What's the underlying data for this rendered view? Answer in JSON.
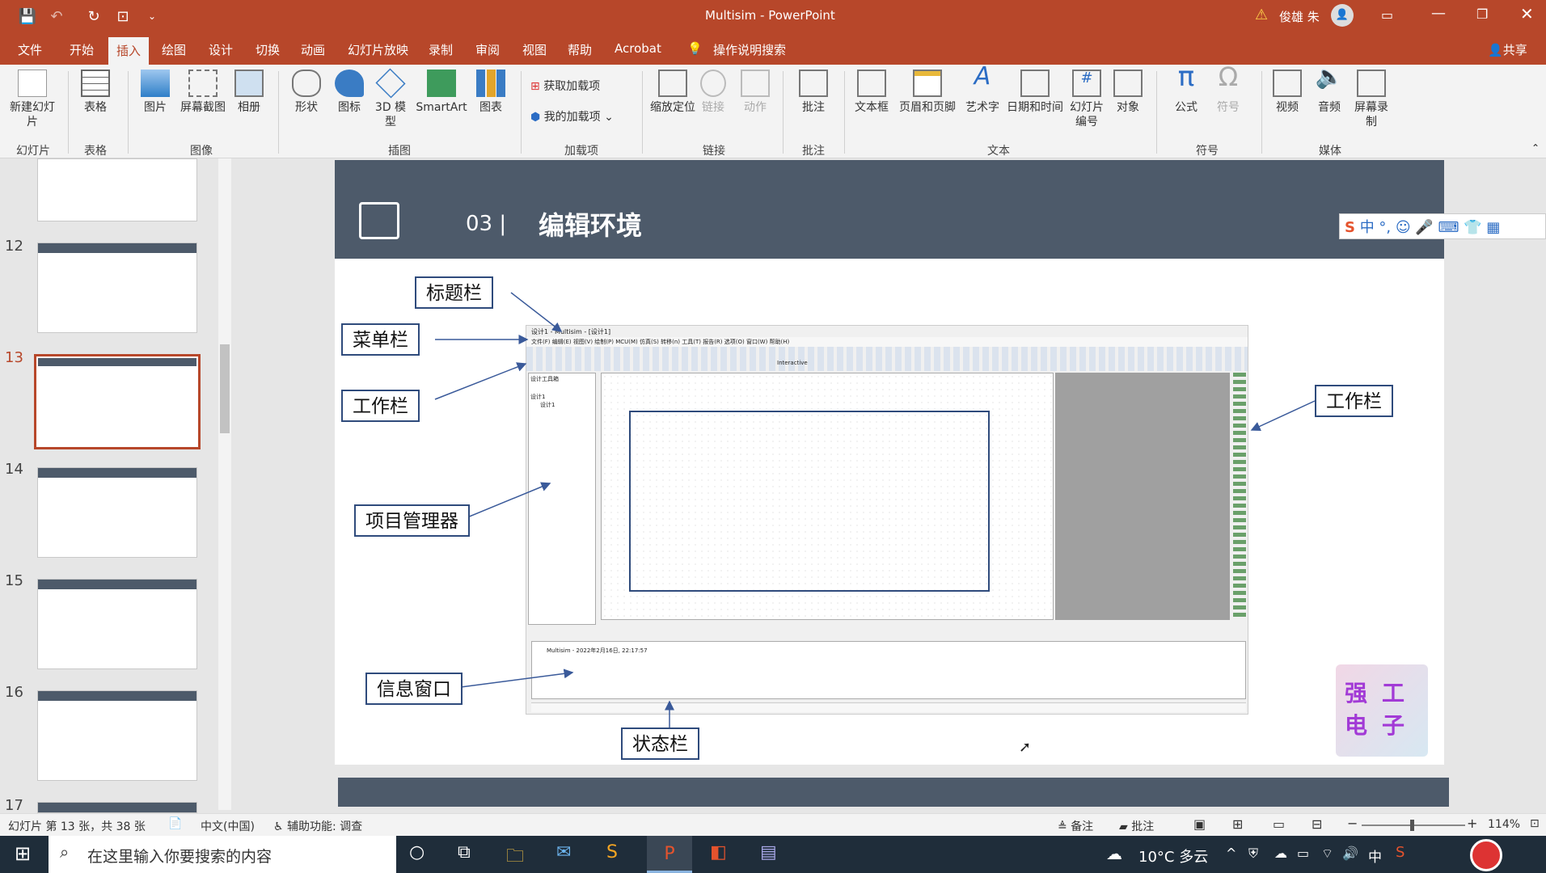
{
  "window": {
    "title": "Multisim  -  PowerPoint",
    "user": "俊雄 朱",
    "share": "共享",
    "warning_icon": "warning-icon"
  },
  "tabs": [
    "文件",
    "开始",
    "插入",
    "绘图",
    "设计",
    "切换",
    "动画",
    "幻灯片放映",
    "录制",
    "审阅",
    "视图",
    "帮助",
    "Acrobat"
  ],
  "tell_me": "操作说明搜索",
  "ribbon": {
    "new_slide": "新建幻灯片",
    "table": "表格",
    "picture": "图片",
    "screenshot": "屏幕截图",
    "album": "相册",
    "shapes": "形状",
    "icons": "图标",
    "3d": "3D 模型",
    "smartart": "SmartArt",
    "chart": "图表",
    "get_addins": "获取加载项",
    "my_addins": "我的加载项",
    "zoom": "缩放定位",
    "link": "链接",
    "action": "动作",
    "comment": "批注",
    "textbox": "文本框",
    "header_footer": "页眉和页脚",
    "wordart": "艺术字",
    "datetime": "日期和时间",
    "slide_num": "幻灯片编号",
    "object": "对象",
    "equation": "公式",
    "symbol": "符号",
    "video": "视频",
    "audio": "音频",
    "screen_rec": "屏幕录制",
    "groups": {
      "slides": "幻灯片",
      "tables": "表格",
      "images": "图像",
      "illustrations": "插图",
      "addins": "加载项",
      "links": "链接",
      "comments": "批注",
      "text": "文本",
      "symbols": "符号",
      "media": "媒体"
    }
  },
  "thumbs": [
    "12",
    "13",
    "14",
    "15",
    "16",
    "17"
  ],
  "slide": {
    "number": "03 |",
    "heading": "编辑环境",
    "callouts": {
      "title_bar": "标题栏",
      "menu_bar": "菜单栏",
      "toolbar_left": "工作栏",
      "project_mgr": "项目管理器",
      "info_window": "信息窗口",
      "status_bar": "状态栏",
      "toolbar_right": "工作栏"
    },
    "shot": {
      "title": "设计1 - Multisim - [设计1]",
      "menus": "文件(F)  编辑(E)  视图(V)  绘制(P)  MCU(M)  仿真(S)  转移(n)  工具(T)  报告(R)  选项(O)  窗口(W)  帮助(H)",
      "panel": "设计工具箱",
      "tree_root": "设计1",
      "tree_child": "设计1",
      "log": "Multisim  -  2022年2月16日, 22:17:57",
      "interactive": "Interactive"
    },
    "logo": "强工电子"
  },
  "status": {
    "slide_info": "幻灯片 第 13 张，共 38 张",
    "lang": "中文(中国)",
    "access": "辅助功能: 调查",
    "notes": "备注",
    "comments": "批注",
    "zoom": "114%"
  },
  "taskbar": {
    "search": "在这里输入你要搜索的内容",
    "weather": "10°C 多云",
    "ime": "中"
  }
}
